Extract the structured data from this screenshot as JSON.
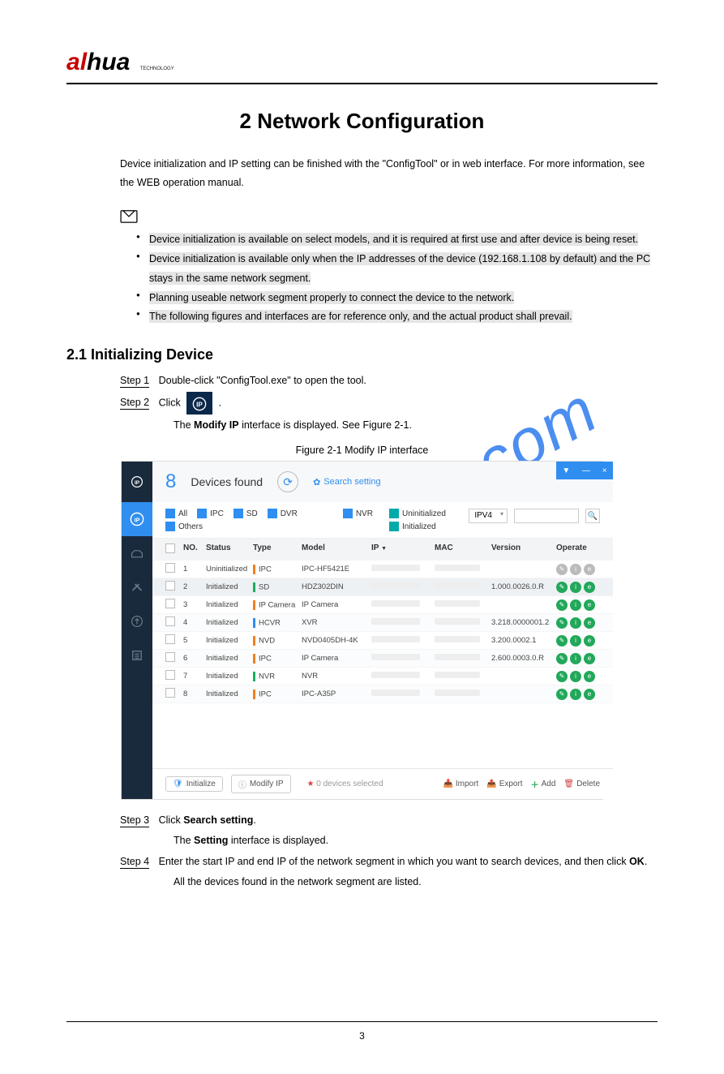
{
  "brand": {
    "letters1": "a",
    "letters2": "hua",
    "sub": "TECHNOLOGY"
  },
  "chapter": {
    "title": "2 Network Configuration"
  },
  "intro": "Device initialization and IP setting can be finished with the \"ConfigTool\" or in web interface. For more information, see the WEB operation manual.",
  "notes": [
    "Device initialization is available on select models, and it is required at first use and after device is being reset.",
    "Device initialization is available only when the IP addresses of the device (192.168.1.108 by default) and the PC stays in the same network segment.",
    "Planning useable network segment properly to connect the device to the network.",
    "The following figures and interfaces are for reference only, and the actual product shall prevail."
  ],
  "section": {
    "heading": "2.1   Initializing Device"
  },
  "steps": {
    "s1_label": "Step 1",
    "s1_text": "Double-click \"ConfigTool.exe\" to open the tool.",
    "s2_label": "Step 2",
    "s2_pre": "Click",
    "s2_post": ".",
    "s2_result_pre": "The",
    "s2_result_bold": "Modify IP",
    "s2_result_post": "interface is displayed. See Figure 2-1.",
    "s3_label": "Step 3",
    "s3_pre": "Click",
    "s3_bold": "Search setting",
    "s3_post": ".",
    "s3_result_pre": "The",
    "s3_result_bold": "Setting",
    "s3_result_post": "interface is displayed.",
    "s4_label": "Step 4",
    "s4_pre": "Enter the start IP and end IP of the network segment in which you want to search devices, and then click",
    "s4_bold": "OK",
    "s4_post": ".",
    "s4_result": "All the devices found in the network segment are listed."
  },
  "figure": {
    "caption": "Figure 2-1 Modify IP interface"
  },
  "configtool": {
    "count": "8",
    "devices_found": "Devices found",
    "search_setting": "Search setting",
    "window_controls": {
      "help": "▼",
      "min": "—",
      "close": "×"
    },
    "filters": {
      "all": "All",
      "ipc": "IPC",
      "sd": "SD",
      "dvr": "DVR",
      "nvr": "NVR",
      "others": "Others",
      "uninit": "Uninitialized",
      "init": "Initialized",
      "ipver": "IPV4"
    },
    "columns": {
      "no": "NO.",
      "status": "Status",
      "type": "Type",
      "model": "Model",
      "ip": "IP",
      "ip_arrow": "▼",
      "mac": "MAC",
      "version": "Version",
      "operate": "Operate"
    },
    "rows": [
      {
        "no": "1",
        "status": "Uninitialized",
        "type": "IPC",
        "bar": "tb-orange",
        "model": "IPC-HF5421E",
        "version": "",
        "op_disabled": true
      },
      {
        "no": "2",
        "status": "Initialized",
        "type": "SD",
        "bar": "tb-green",
        "model": "HDZ302DIN",
        "version": "1.000.0026.0.R",
        "op_disabled": false
      },
      {
        "no": "3",
        "status": "Initialized",
        "type": "IP Camera",
        "bar": "tb-orange",
        "model": "IP Camera",
        "version": "",
        "op_disabled": false
      },
      {
        "no": "4",
        "status": "Initialized",
        "type": "HCVR",
        "bar": "tb-blue",
        "model": "XVR",
        "version": "3.218.0000001.2",
        "op_disabled": false
      },
      {
        "no": "5",
        "status": "Initialized",
        "type": "NVD",
        "bar": "tb-orange",
        "model": "NVD0405DH-4K",
        "version": "3.200.0002.1",
        "op_disabled": false
      },
      {
        "no": "6",
        "status": "Initialized",
        "type": "IPC",
        "bar": "tb-orange",
        "model": "IP Camera",
        "version": "2.600.0003.0.R",
        "op_disabled": false
      },
      {
        "no": "7",
        "status": "Initialized",
        "type": "NVR",
        "bar": "tb-green",
        "model": "NVR",
        "version": "",
        "op_disabled": false
      },
      {
        "no": "8",
        "status": "Initialized",
        "type": "IPC",
        "bar": "tb-orange",
        "model": "IPC-A35P",
        "version": "",
        "op_disabled": false
      }
    ],
    "footer": {
      "initialize": "Initialize",
      "modify_ip": "Modify IP",
      "selected_count": "0",
      "selected_text": "devices selected",
      "import": "Import",
      "export": "Export",
      "add": "Add",
      "delete": "Delete"
    }
  },
  "footer_page": "3",
  "watermark": "manualshive.com"
}
